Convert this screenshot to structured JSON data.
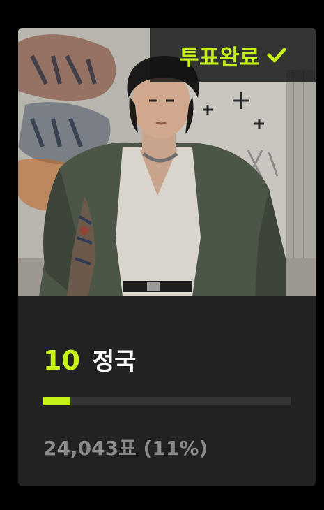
{
  "vote_badge": {
    "label": "투표완료",
    "icon": "check-icon"
  },
  "candidate": {
    "rank": "10",
    "name": "정국",
    "vote_text": "24,043표 (11%)",
    "vote_share": 0.11
  },
  "colors": {
    "accent": "#c6f21a",
    "card_background": "#222222",
    "track": "#353535",
    "muted_text": "#8a8a8a"
  }
}
